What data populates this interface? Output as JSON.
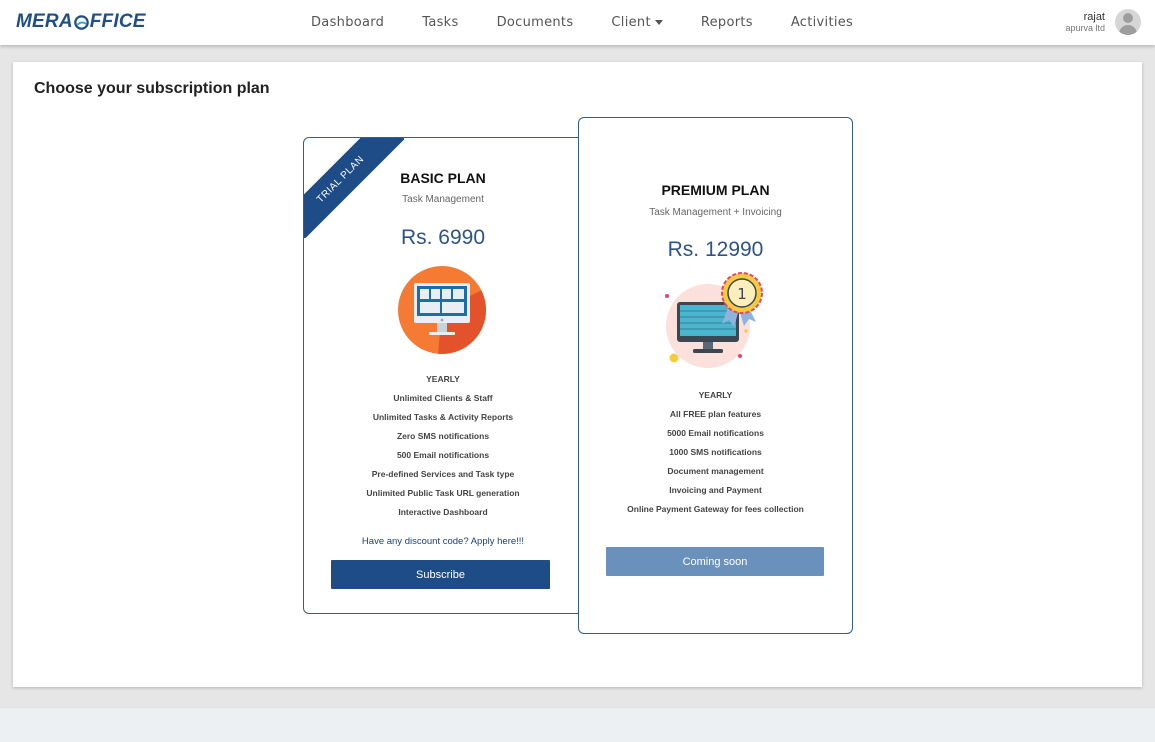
{
  "brand": {
    "name_part1": "MERA",
    "name_part2": "FFICE"
  },
  "nav": {
    "items": [
      {
        "label": "Dashboard"
      },
      {
        "label": "Tasks"
      },
      {
        "label": "Documents"
      },
      {
        "label": "Client"
      },
      {
        "label": "Reports"
      },
      {
        "label": "Activities"
      }
    ]
  },
  "user": {
    "name": "rajat",
    "company": "apurva ltd"
  },
  "page": {
    "title": "Choose your subscription plan"
  },
  "plans": {
    "basic": {
      "ribbon": "TRIAL PLAN",
      "name": "BASIC PLAN",
      "subtitle": "Task Management",
      "price": "Rs. 6990",
      "billing": "YEARLY",
      "features": [
        "Unlimited Clients & Staff",
        "Unlimited Tasks & Activity Reports",
        "Zero SMS notifications",
        "500 Email notifications",
        "Pre-defined Services and Task type",
        "Unlimited Public Task URL generation",
        "Interactive Dashboard"
      ],
      "discount_link": "Have any discount code? Apply here!!!",
      "button_label": "Subscribe"
    },
    "premium": {
      "name": "PREMIUM PLAN",
      "subtitle": "Task Management + Invoicing",
      "price": "Rs. 12990",
      "billing": "YEARLY",
      "features": [
        "All FREE plan features",
        "5000 Email notifications",
        "1000 SMS notifications",
        "Document management",
        "Invoicing and Payment",
        "Online Payment Gateway for fees collection"
      ],
      "badge_number": "1",
      "button_label": "Coming soon"
    }
  },
  "colors": {
    "brand_blue": "#1f4f86",
    "subscribe_button": "#1e4c86",
    "coming_soon_button": "#6a91bb"
  }
}
